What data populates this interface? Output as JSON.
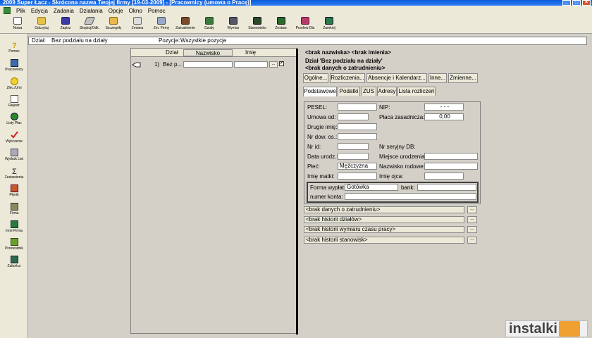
{
  "window": {
    "title": "2009 Super Łacz - Skrócona nazwa Twojej firmy [19-03-2009] - [Pracownicy (umowa o Pracę)]"
  },
  "menu": [
    "Plik",
    "Edycja",
    "Zadania",
    "Działania",
    "Opcje",
    "Okno",
    "Pomoc"
  ],
  "toolbar": [
    {
      "label": "Nowa",
      "icon": "new-doc-icon"
    },
    {
      "label": "Odczytaj",
      "icon": "open-folder-icon"
    },
    {
      "label": "Zapisz",
      "icon": "save-icon"
    },
    {
      "label": "Skopiuj/Odk.",
      "icon": "edit-pencil-icon"
    },
    {
      "label": "Szczegóły",
      "icon": "details-icon"
    },
    {
      "label": "Zmiana",
      "icon": "change-icon"
    },
    {
      "label": "Zm. Firmy",
      "icon": "company-change-icon"
    },
    {
      "label": "Zatrudnienie",
      "icon": "employment-icon"
    },
    {
      "label": "Działy",
      "icon": "departments-icon"
    },
    {
      "label": "Wymiar",
      "icon": "dimension-icon"
    },
    {
      "label": "Stanowisko",
      "icon": "position-icon"
    },
    {
      "label": "Zestaw.",
      "icon": "set-icon"
    },
    {
      "label": "Przelew Dla",
      "icon": "transfer-icon"
    },
    {
      "label": "Zamknij",
      "icon": "close-icon"
    }
  ],
  "sidebar": [
    {
      "label": "Pomoc",
      "icon": "help-icon"
    },
    {
      "label": "Pracownicy",
      "icon": "employees-icon"
    },
    {
      "label": "Zlec./Umi",
      "icon": "smiley-icon"
    },
    {
      "label": "Rejestr",
      "icon": "register-icon"
    },
    {
      "label": "Listy Płac",
      "icon": "payroll-icon"
    },
    {
      "label": "Wyliczenie",
      "icon": "checkmark-icon"
    },
    {
      "label": "Wydruk List",
      "icon": "print-icon"
    },
    {
      "label": "Zestawienia",
      "icon": "sigma-icon"
    },
    {
      "label": "Płynik",
      "icon": "flow-icon"
    },
    {
      "label": "Firma",
      "icon": "company-icon"
    },
    {
      "label": "Inne Firma",
      "icon": "other-company-icon"
    },
    {
      "label": "Przewodnik",
      "icon": "guide-icon"
    },
    {
      "label": "Zakończ",
      "icon": "exit-icon"
    }
  ],
  "dept_bar": {
    "dzial_label": "Dział:",
    "dzial_value": "Bez podziału na działy",
    "pozycje_label": "Pozycje:",
    "pozycje_value": "Wszystkie pozycje"
  },
  "list": {
    "headers": [
      "Dział",
      "Nazwisko",
      "Imię"
    ],
    "row": {
      "num": "1)",
      "dzial": "Bez p...",
      "ellipsis": "..."
    }
  },
  "details": {
    "line1": "<brak nazwiska> <brak imienia>",
    "line2": "Dział 'Bez podziału na działy'",
    "line3": "<brak danych o zatrudnieniu>",
    "buttons": [
      "Ogólne...",
      "Rozliczenia...",
      "Absencje i Kalendarz...",
      "Inne...",
      "Zmienne..."
    ],
    "tabs": [
      "Podstawowe",
      "Podatki",
      "ZUS",
      "Adresy",
      "Lista rozliczeń"
    ],
    "fields": {
      "pesel": "PESEL:",
      "nip": "NIP:",
      "nip_value": "- - -",
      "umowa_od": "Umowa od:",
      "placa": "Płaca zasadnicza:",
      "placa_value": "0,00",
      "drugie_imie": "Drugie imię:",
      "nr_dow": "Nr dow. os.:",
      "nr_id": "Nr id:",
      "nr_seryjny": "Nr seryjny DB:",
      "data_urodz": "Data urodz.:",
      "miejsce": "Miejsce urodzenia:",
      "plec": "Płeć:",
      "plec_value": "Mężczyzna",
      "nazwisko_rodowe": "Nazwisko rodowe:",
      "imie_matki": "Imię matki:",
      "imie_ojca": "Imię ojca:",
      "forma_label": "Forma wypłat:",
      "forma_value": "Gotówka",
      "bank": "bank:",
      "konto": "numer konta:"
    },
    "history": [
      "<brak danych o zatrudnieniu>",
      "<brak historii działów>",
      "<brak historii wymiaru czasu pracy>",
      "<brak historii stanowisk>"
    ],
    "hist_btn": "..."
  },
  "watermark": "instalki"
}
